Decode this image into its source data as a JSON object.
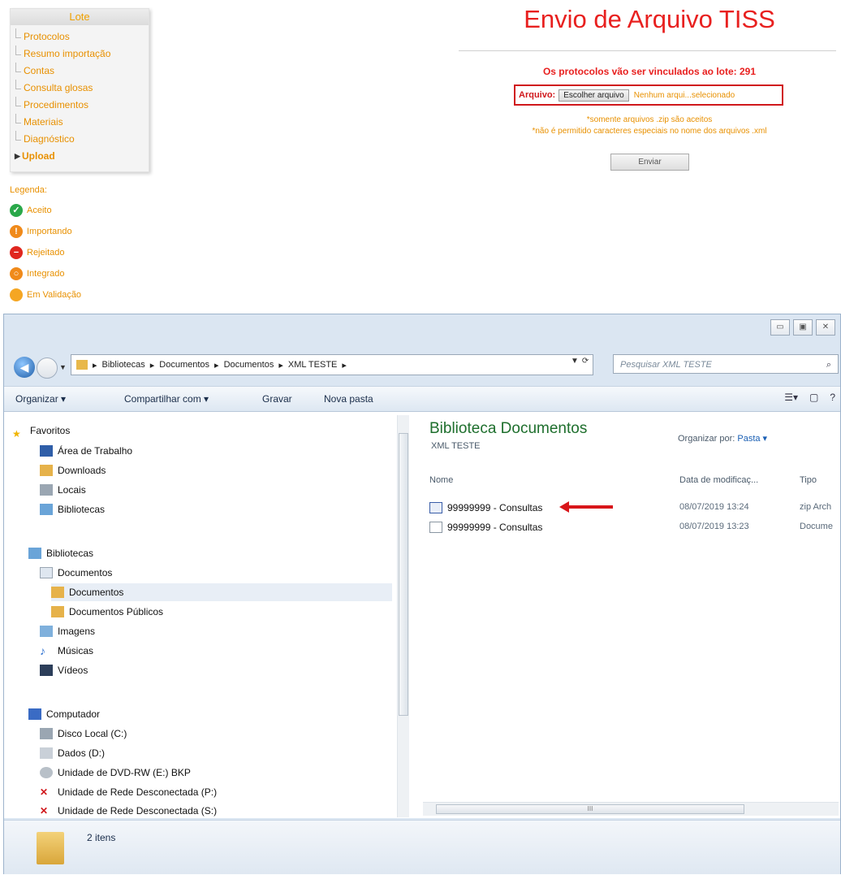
{
  "web": {
    "menu": {
      "title": "Lote",
      "items": [
        "Protocolos",
        "Resumo importação",
        "Contas",
        "Consulta glosas",
        "Procedimentos",
        "Materiais",
        "Diagnóstico",
        "Upload"
      ]
    },
    "legend": {
      "title": "Legenda:",
      "items": [
        {
          "label": "Aceito",
          "color": "#2aa84a",
          "symbol": "✓"
        },
        {
          "label": "Importando",
          "color": "#f08a1a",
          "symbol": "!"
        },
        {
          "label": "Rejeitado",
          "color": "#e0261f",
          "symbol": "−"
        },
        {
          "label": "Integrado",
          "color": "#f08a1a",
          "symbol": "○"
        },
        {
          "label": "Em Validação",
          "color": "#f5a623",
          "symbol": ""
        }
      ]
    },
    "page_title": "Envio de Arquivo TISS",
    "lote_text": "Os protocolos vão ser vinculados ao lote: 291",
    "file_label": "Arquivo:",
    "file_button": "Escolher arquivo",
    "file_none": "Nenhum arqui...selecionado",
    "note1": "*somente arquivos .zip são aceitos",
    "note2": "*não é permitido caracteres especiais no nome dos arquivos .xml",
    "send_button": "Enviar"
  },
  "explorer": {
    "controls": [
      "▭",
      "▣",
      "✕"
    ],
    "address": [
      "Bibliotecas",
      "Documentos",
      "Documentos",
      "XML TESTE"
    ],
    "search_placeholder": "Pesquisar XML TESTE",
    "toolbar": {
      "organize": "Organizar ▾",
      "share": "Compartilhar com ▾",
      "burn": "Gravar",
      "new_folder": "Nova pasta"
    },
    "nav": {
      "favorites": "Favoritos",
      "desktop": "Área de Trabalho",
      "downloads": "Downloads",
      "locais": "Locais",
      "libraries_fav": "Bibliotecas",
      "libraries": "Bibliotecas",
      "documentos": "Documentos",
      "documentos_sel": "Documentos",
      "documentos_pub": "Documentos Públicos",
      "imagens": "Imagens",
      "musicas": "Músicas",
      "videos": "Vídeos",
      "computer": "Computador",
      "disk_c": "Disco Local (C:)",
      "disk_d": "Dados (D:)",
      "dvd": "Unidade de DVD-RW (E:) BKP",
      "net_p": "Unidade de Rede Desconectada (P:)",
      "net_s": "Unidade de Rede Desconectada (S:)"
    },
    "library_title": "Biblioteca Documentos",
    "library_sub": "XML TESTE",
    "organize_by_label": "Organizar por:",
    "organize_by_value": "Pasta ▾",
    "columns": {
      "name": "Nome",
      "date": "Data de modificaç...",
      "type": "Tipo"
    },
    "files": [
      {
        "name": "99999999 - Consultas",
        "date": "08/07/2019 13:24",
        "type": "zip Arch"
      },
      {
        "name": "99999999 - Consultas",
        "date": "08/07/2019 13:23",
        "type": "Docume"
      }
    ],
    "status": "2 itens",
    "hscroll_grip": "III"
  }
}
